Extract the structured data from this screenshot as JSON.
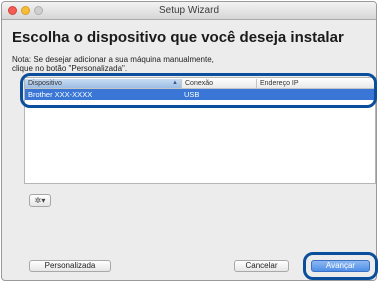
{
  "window": {
    "title": "Setup Wizard"
  },
  "heading": "Escolha o dispositivo que você deseja instalar",
  "note": {
    "line1": "Nota: Se desejar adicionar a sua máquina manualmente,",
    "line2": "clique no botão \"Personalizada\"."
  },
  "table": {
    "columns": [
      "Dispositivo",
      "Conexão",
      "Endereço IP"
    ],
    "rows": [
      {
        "device": "Brother XXX-XXXX",
        "connection": "USB",
        "ip": ""
      }
    ]
  },
  "icons": {
    "gear": "gear-icon",
    "sort": "sort-ascending-icon"
  },
  "gear_button": {
    "glyph": "✲▾"
  },
  "buttons": {
    "custom": "Personalizada",
    "cancel": "Cancelar",
    "next": "Avançar"
  },
  "colors": {
    "selection": "#3a76d6",
    "callout": "#0b4f9c",
    "default_button": "#4f8fe8"
  }
}
